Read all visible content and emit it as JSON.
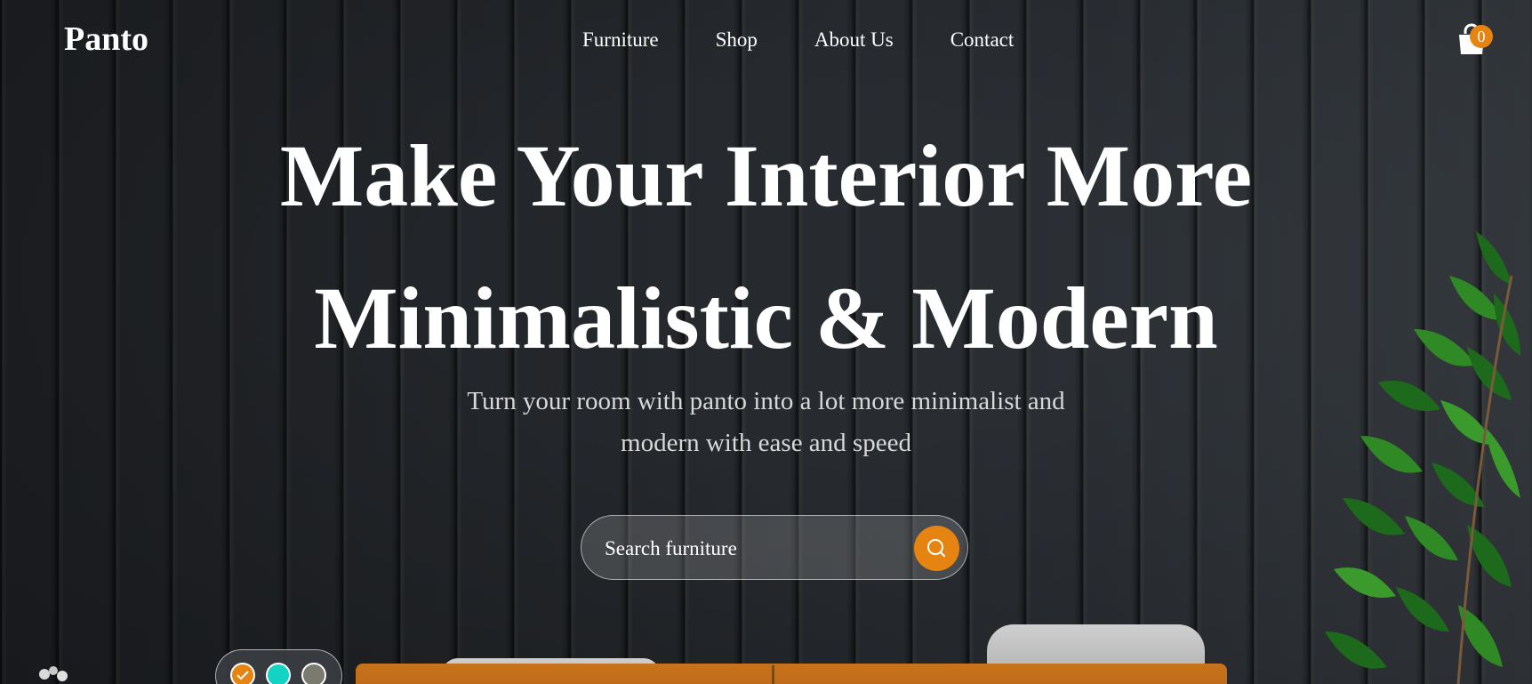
{
  "brand": {
    "logo": "Panto"
  },
  "nav": {
    "items": [
      {
        "label": "Furniture"
      },
      {
        "label": "Shop"
      },
      {
        "label": "About Us"
      },
      {
        "label": "Contact"
      }
    ]
  },
  "cart": {
    "count": "0",
    "icon": "shopping-bag-icon"
  },
  "hero": {
    "headline_line1": "Make Your Interior More",
    "headline_line2": "Minimalistic & Modern",
    "subline_line1": "Turn your room with panto into a lot more minimalist and",
    "subline_line2": "modern with ease and speed"
  },
  "search": {
    "placeholder": "Search furniture",
    "value": "",
    "icon": "search-icon"
  },
  "swatches": {
    "options": [
      {
        "color": "#e58411",
        "selected": true
      },
      {
        "color": "#12d3c4",
        "selected": false
      },
      {
        "color": "#7a7a6e",
        "selected": false
      }
    ]
  },
  "colors": {
    "accent": "#e58411",
    "text": "#ffffff",
    "muted_text": "#d8d8d8",
    "background": "#24272b"
  }
}
